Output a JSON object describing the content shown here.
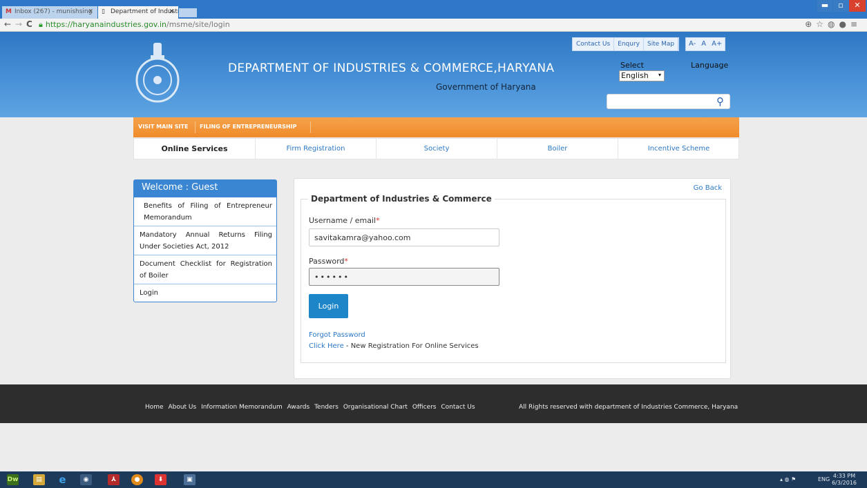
{
  "browser": {
    "tabs": [
      {
        "label": "Inbox (267) - munishsing",
        "icon": "gmail-icon"
      },
      {
        "label": "Department of Industrial",
        "icon": "page-icon"
      }
    ],
    "url_host": "https://haryanaindustries.gov.in",
    "url_path": "/msme/site/login"
  },
  "header": {
    "title": "DEPARTMENT OF INDUSTRIES & COMMERCE,HARYANA",
    "subtitle": "Government of Haryana",
    "top_links": [
      "Contact Us",
      "Enqury",
      "Site Map"
    ],
    "font_sizes": [
      "A-",
      "A",
      "A+"
    ],
    "select_label": "Select",
    "language_label": "Language",
    "language_value": "English"
  },
  "orange_nav": [
    "VISIT MAIN SITE",
    "FILING OF ENTREPRENEURSHIP"
  ],
  "services": [
    "Online Services",
    "Firm Registration",
    "Society",
    "Boiler",
    "Incentive Scheme"
  ],
  "sidebar": {
    "title": "Welcome : Guest",
    "items": [
      "Benefits of Filing of Entrepreneur Memorandum",
      "Mandatory Annual Returns Filing Under Societies Act, 2012",
      "Document Checklist for Registration of Boiler",
      "Login"
    ]
  },
  "login": {
    "go_back": "Go Back",
    "legend": "Department of Industries & Commerce",
    "username_label": "Username / email",
    "username_value": "savitakamra@yahoo.com",
    "password_label": "Password",
    "password_value": "••••••",
    "required_mark": "*",
    "login_button": "Login",
    "forgot": "Forgot Password",
    "click_here": "Click Here",
    "new_reg": " - New Registration For Online Services"
  },
  "footer": {
    "links": [
      "Home",
      "About Us",
      "Information Memorandum",
      "Awards",
      "Tenders",
      "Organisational Chart",
      "Officers",
      "Contact Us"
    ],
    "copyright": "All Rights reserved with department of Industries Commerce, Haryana"
  },
  "taskbar": {
    "lang": "ENG",
    "time": "4:33 PM",
    "date": "6/3/2016"
  },
  "colors": {
    "header_blue": "#2e78c4",
    "orange": "#ef8b2a",
    "link_blue": "#2b78c6",
    "login_button": "#1d86c8"
  }
}
